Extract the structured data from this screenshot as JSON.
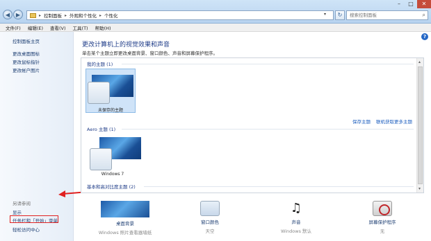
{
  "address": {
    "segments": [
      "控制面板",
      "外观和个性化",
      "个性化"
    ],
    "search_placeholder": "搜索控制面板"
  },
  "menu": [
    "文件(F)",
    "编辑(E)",
    "查看(V)",
    "工具(T)",
    "帮助(H)"
  ],
  "sidebar": {
    "links": [
      "控制面板主页",
      "更改桌面图标",
      "更改鼠标指针",
      "更改帐户图片"
    ],
    "see_also_title": "另请参阅",
    "see_also": [
      "显示",
      "任务栏和「开始」菜单",
      "轻松访问中心"
    ]
  },
  "main": {
    "title": "更改计算机上的视觉效果和声音",
    "subtitle": "单击某个主题立即更改桌面背景、窗口颜色、声音和屏幕保护程序。",
    "my_themes_title": "我的主题 (1)",
    "unsaved_theme": "未保存的主题",
    "save_theme": "保存主题",
    "get_more": "联机获取更多主题",
    "aero_title": "Aero 主题 (1)",
    "win7_theme": "Windows 7",
    "basic_title": "基本和高对比度主题 (2)"
  },
  "bottom": [
    {
      "label": "桌面背景",
      "sub": "Windows 照片查看器墙纸",
      "icon": "wallpaper-icon"
    },
    {
      "label": "窗口颜色",
      "sub": "天空",
      "icon": "window-color-icon"
    },
    {
      "label": "声音",
      "sub": "Windows 默认",
      "icon": "sound-icon"
    },
    {
      "label": "屏幕保护程序",
      "sub": "无",
      "icon": "screensaver-icon"
    }
  ],
  "accent": "#e02020"
}
